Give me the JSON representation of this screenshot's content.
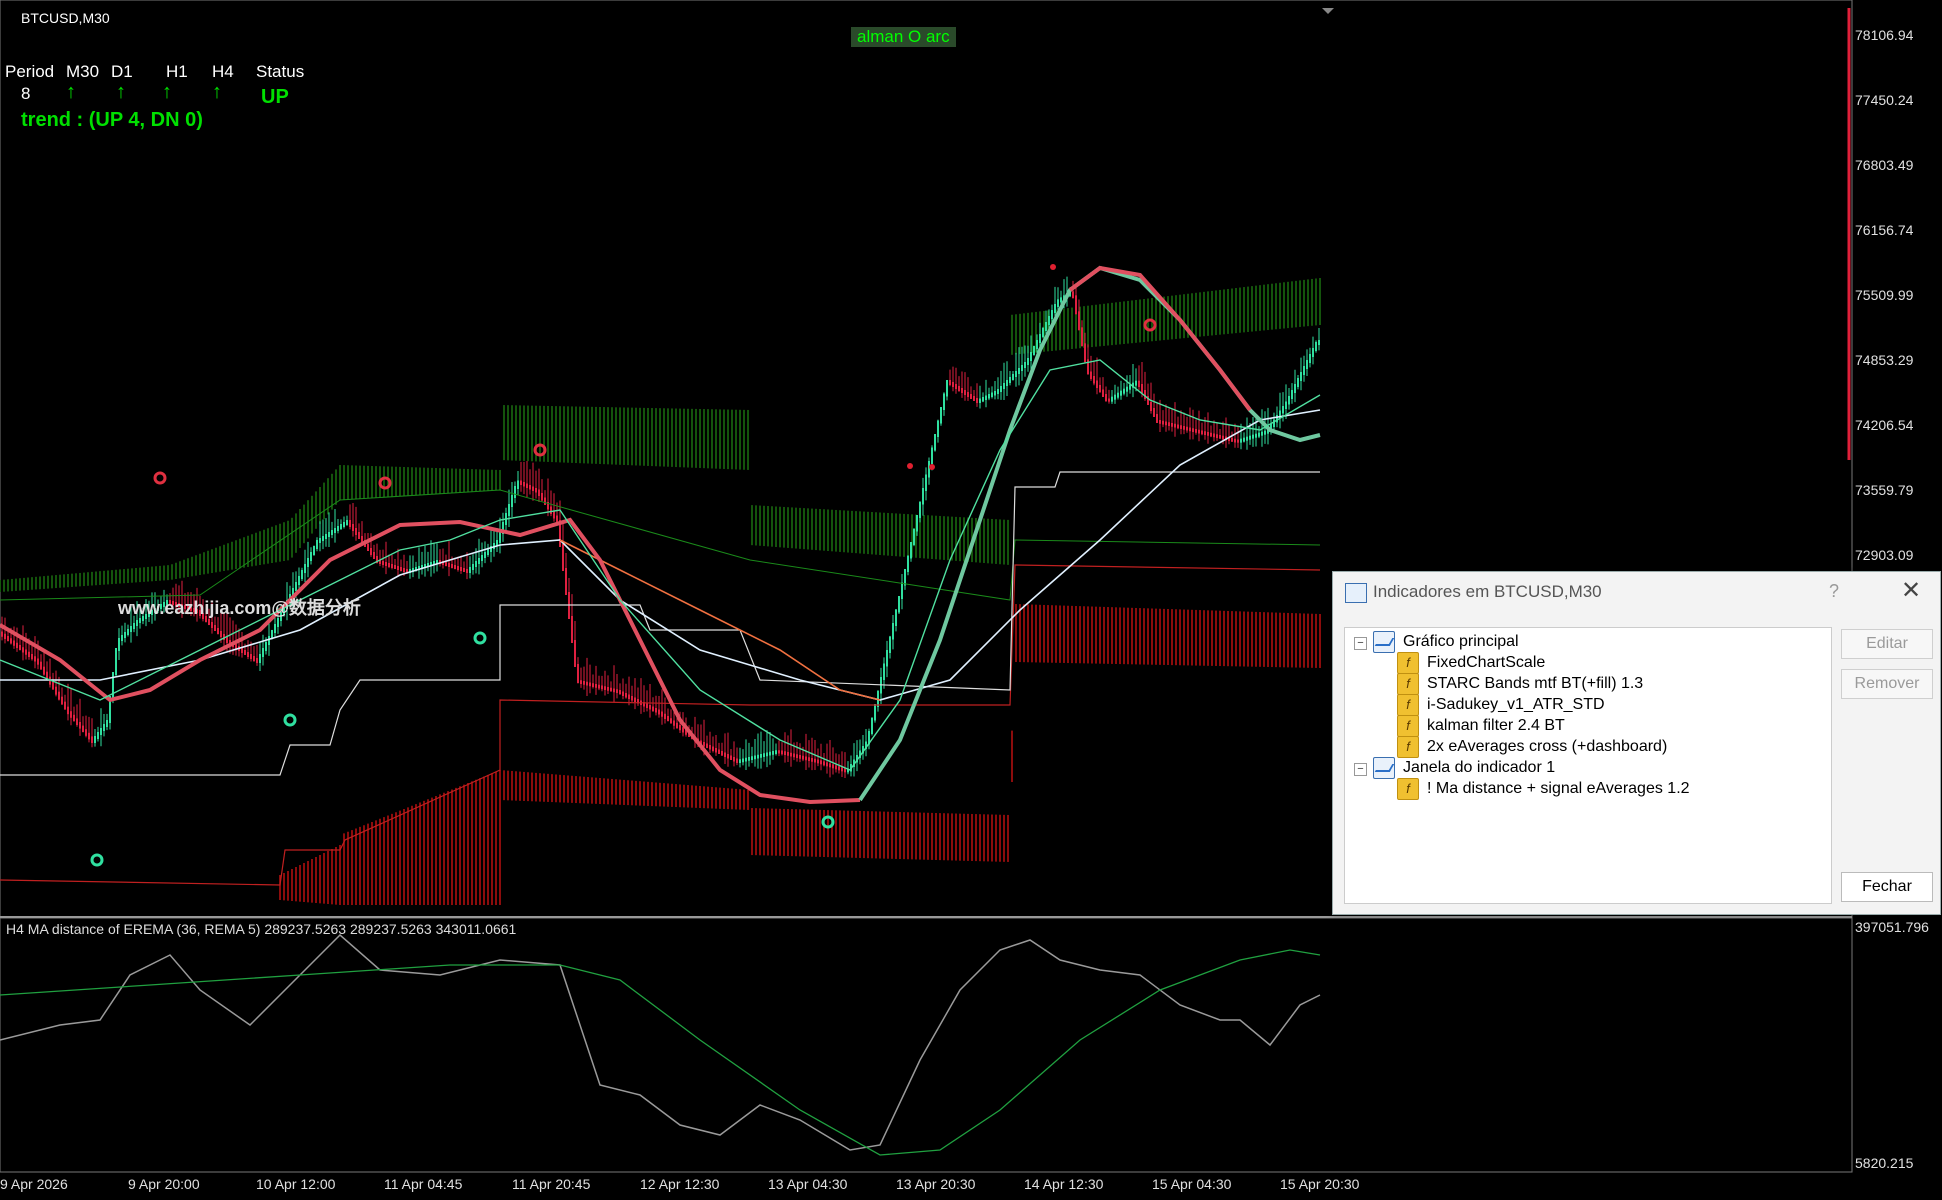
{
  "chart": {
    "symbol_label": "BTCUSD,M30",
    "indicator_tag": "alman O arc",
    "watermark": "www.eazhijia.com@数据分析",
    "subwindow_label": "H4 MA distance of EREMA (36, REMA 5) 289237.5263 289237.5263 343011.0661",
    "price_axis": [
      "78106.94",
      "77450.24",
      "76803.49",
      "76156.74",
      "75509.99",
      "74853.29",
      "74206.54",
      "73559.79",
      "72903.09"
    ],
    "sub_axis": [
      "397051.796",
      "5820.215"
    ],
    "time_axis": [
      "9 Apr 2026",
      "9 Apr 20:00",
      "10 Apr 12:00",
      "11 Apr 04:45",
      "11 Apr 20:45",
      "12 Apr 12:30",
      "13 Apr 04:30",
      "13 Apr 20:30",
      "14 Apr 12:30",
      "15 Apr 04:30",
      "15 Apr 20:30"
    ]
  },
  "dashboard": {
    "headers": [
      "Period",
      "M30",
      "D1",
      "H1",
      "H4",
      "Status"
    ],
    "period_value": "8",
    "arrow_glyph": "↑",
    "status_value": "UP",
    "trend_text": "trend : (UP 4, DN 0)"
  },
  "dialog": {
    "title": "Indicadores em BTCUSD,M30",
    "help": "?",
    "close": "✕",
    "tree": {
      "main_group": "Gráfico principal",
      "main_items": [
        "FixedChartScale",
        "STARC Bands mtf BT(+fill) 1.3",
        "i-Sadukey_v1_ATR_STD",
        "kalman filter 2.4 BT",
        "2x eAverages cross (+dashboard)"
      ],
      "sub_group": "Janela do indicador 1",
      "sub_items": [
        "! Ma distance + signal eAverages 1.2"
      ]
    },
    "buttons": {
      "edit": "Editar",
      "remove": "Remover",
      "close": "Fechar"
    }
  },
  "colors": {
    "background": "#000000",
    "upper_band": "#1a6a10",
    "lower_band": "#b01010",
    "kalman": "#e05060",
    "kalman_up": "#6fc8a0",
    "candle_up": "#30e0a0",
    "candle_down": "#e02040",
    "ma_white": "#ffffff",
    "ma_orange": "#f07040",
    "sub_gray": "#9a9a9a",
    "sub_green": "#20a040",
    "current_price_marker": "#e0203a"
  }
}
